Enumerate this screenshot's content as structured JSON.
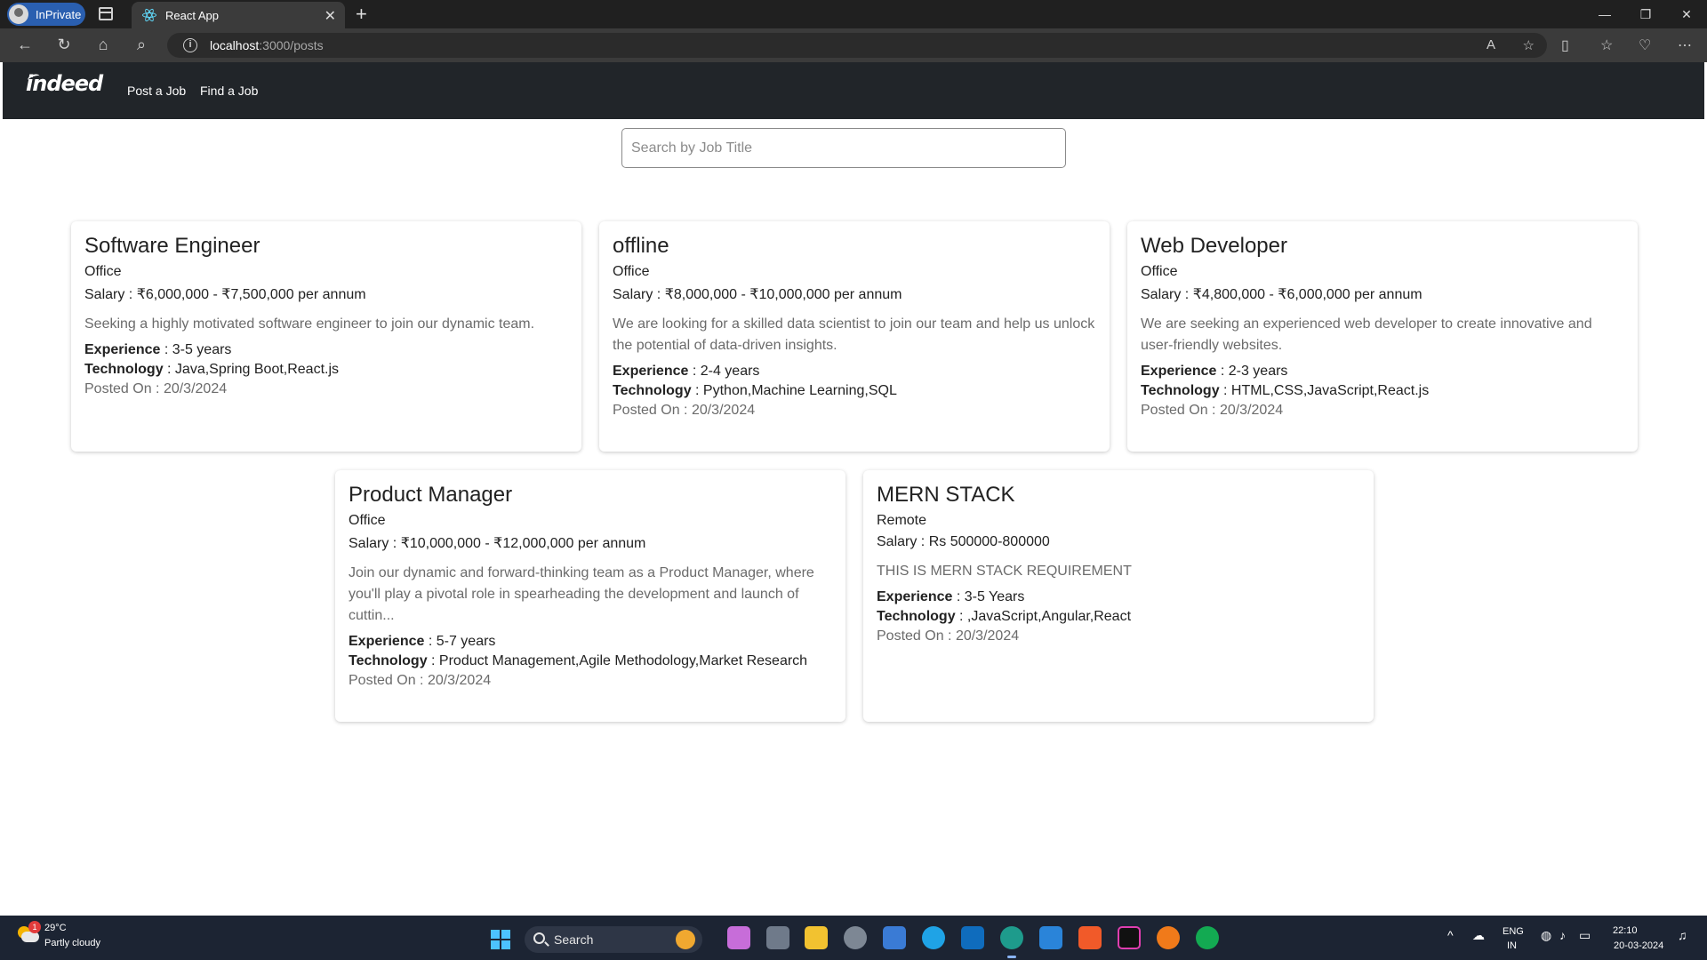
{
  "browser": {
    "profile_label": "InPrivate",
    "tab_title": "React App",
    "tab_close": "✕",
    "new_tab": "+",
    "url_host": "localhost",
    "url_path": ":3000/posts",
    "window_controls": [
      "—",
      "❐",
      "✕"
    ]
  },
  "navbar": {
    "brand": "indeed",
    "links": [
      "Post a Job",
      "Find a Job"
    ]
  },
  "search": {
    "placeholder": "Search by Job Title"
  },
  "jobs": [
    {
      "title": "Software Engineer",
      "type": "Office",
      "salary": "Salary : ₹6,000,000 - ₹7,500,000 per annum",
      "description": "Seeking a highly motivated software engineer to join our dynamic team.",
      "experience_label": "Experience",
      "experience": " : 3-5 years",
      "technology_label": "Technology",
      "technology": " : Java,Spring Boot,React.js",
      "posted": "Posted On : 20/3/2024"
    },
    {
      "title": "offline",
      "type": "Office",
      "salary": "Salary : ₹8,000,000 - ₹10,000,000 per annum",
      "description": "We are looking for a skilled data scientist to join our team and help us unlock the potential of data-driven insights.",
      "experience_label": "Experience",
      "experience": " : 2-4 years",
      "technology_label": "Technology",
      "technology": " : Python,Machine Learning,SQL",
      "posted": "Posted On : 20/3/2024"
    },
    {
      "title": "Web Developer",
      "type": "Office",
      "salary": "Salary : ₹4,800,000 - ₹6,000,000 per annum",
      "description": "We are seeking an experienced web developer to create innovative and user-friendly websites.",
      "experience_label": "Experience",
      "experience": " : 2-3 years",
      "technology_label": "Technology",
      "technology": " : HTML,CSS,JavaScript,React.js",
      "posted": "Posted On : 20/3/2024"
    },
    {
      "title": "Product Manager",
      "type": "Office",
      "salary": "Salary : ₹10,000,000 - ₹12,000,000 per annum",
      "description": "Join our dynamic and forward-thinking team as a Product Manager, where you'll play a pivotal role in spearheading the development and launch of cuttin...",
      "experience_label": "Experience",
      "experience": " : 5-7 years",
      "technology_label": "Technology",
      "technology": " : Product Management,Agile Methodology,Market Research",
      "posted": "Posted On : 20/3/2024"
    },
    {
      "title": "MERN STACK",
      "type": "Remote",
      "salary": "Salary : Rs 500000-800000",
      "description": "THIS IS MERN STACK REQUIREMENT",
      "experience_label": "Experience",
      "experience": " : 3-5 Years",
      "technology_label": "Technology",
      "technology": " : ,JavaScript,Angular,React",
      "posted": "Posted On : 20/3/2024"
    }
  ],
  "taskbar": {
    "weather_badge": "1",
    "weather_temp": "29°C",
    "weather_desc": "Partly cloudy",
    "search_label": "Search",
    "lang_top": "ENG",
    "lang_bottom": "IN",
    "time": "22:10",
    "date": "20-03-2024"
  },
  "colors": {
    "navbar_bg": "#212529",
    "title_bar": "#202020",
    "taskbar_bg": "#1c2433",
    "accent": "#2a5fb0"
  }
}
